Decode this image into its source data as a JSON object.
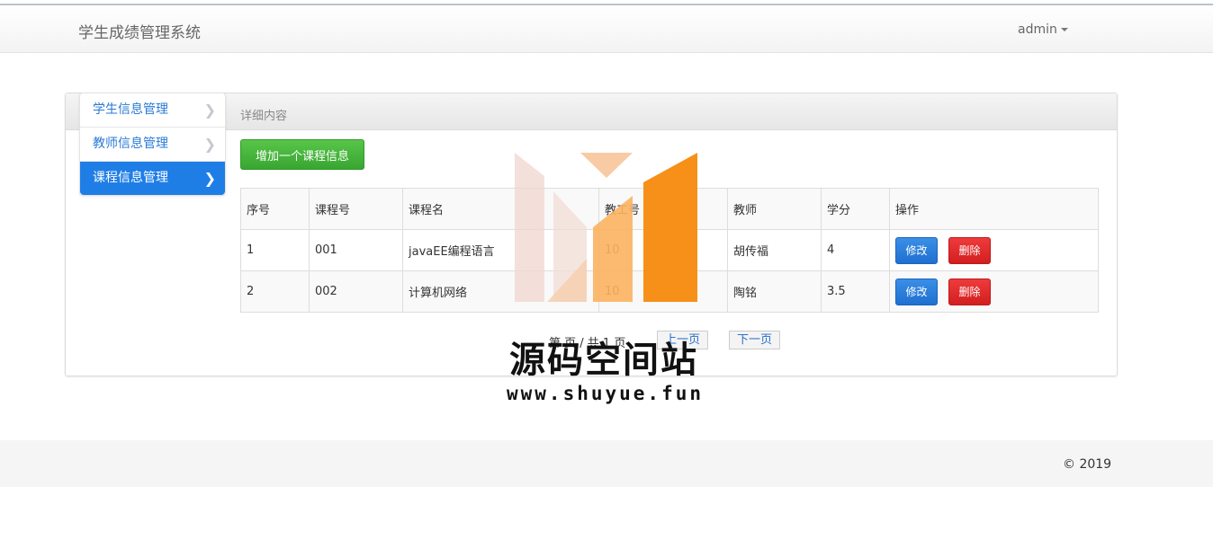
{
  "app": {
    "brand": "学生成绩管理系统",
    "user": "admin"
  },
  "sidebar": {
    "items": [
      {
        "label": "学生信息管理",
        "active": false
      },
      {
        "label": "教师信息管理",
        "active": false
      },
      {
        "label": "课程信息管理",
        "active": true
      }
    ]
  },
  "panel": {
    "title": "详细内容"
  },
  "toolbar": {
    "add_label": "增加一个课程信息"
  },
  "table": {
    "headers": [
      "序号",
      "课程号",
      "课程名",
      "教工号",
      "教师",
      "学分",
      "操作"
    ],
    "rows": [
      {
        "index": "1",
        "course_no": "001",
        "course_name": "javaEE编程语言",
        "teacher_no": "10",
        "teacher": "胡传福",
        "credit": "4"
      },
      {
        "index": "2",
        "course_no": "002",
        "course_name": "计算机网络",
        "teacher_no": "10",
        "teacher": "陶铭",
        "credit": "3.5"
      }
    ],
    "edit_label": "修改",
    "delete_label": "删除"
  },
  "pagination": {
    "info": "第   页 / 共 1 页",
    "prev_label": "上一页",
    "next_label": "下一页"
  },
  "watermark": {
    "title": "源码空间站",
    "url": "www.shuyue.fun"
  },
  "footer": {
    "copyright": "© 2019"
  }
}
